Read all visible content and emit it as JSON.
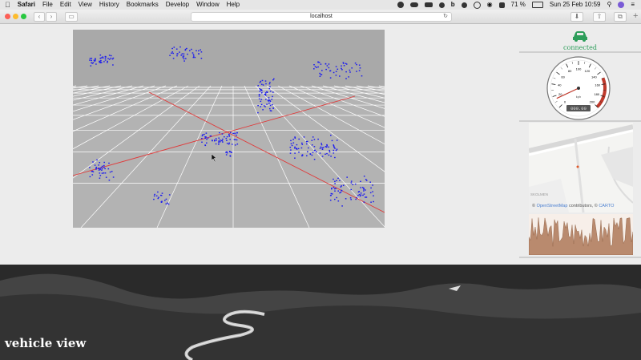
{
  "menubar": {
    "app": "Safari",
    "items": [
      "File",
      "Edit",
      "View",
      "History",
      "Bookmarks",
      "Develop",
      "Window",
      "Help"
    ],
    "battery": "71 %",
    "datetime": "Sun 25 Feb  10:59"
  },
  "browser": {
    "url": "localhost"
  },
  "vehicle": {
    "label": "vehicle view"
  },
  "status": {
    "connected_label": "connected",
    "color": "#2e9e5b"
  },
  "speedometer": {
    "unit": "kph",
    "ticks": [
      "0",
      "20",
      "40",
      "60",
      "80",
      "100",
      "120",
      "140",
      "160",
      "180",
      "200"
    ],
    "readout": "000.00",
    "value": 0
  },
  "map": {
    "street_label": "SKOLMEN",
    "attribution_prefix": "© ",
    "osm": "OpenStreetMap",
    "contributors": " contributors, © ",
    "carto": "CARTO"
  },
  "colors": {
    "lidar_points": "#1a1af0",
    "axis_lines": "#e03a3a",
    "gauge_red": "#c0392b",
    "spark_fill": "#b98a6e"
  }
}
